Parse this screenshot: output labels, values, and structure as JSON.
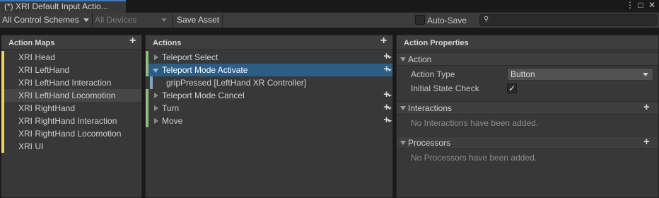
{
  "window": {
    "tab_title": "(*) XRI Default Input Actio...",
    "menu_glyph": "⋮",
    "maximize_glyph": "□",
    "close_glyph": "✕"
  },
  "toolbar": {
    "control_schemes": "All Control Schemes",
    "devices": "All Devices",
    "save_asset": "Save Asset",
    "auto_save": "Auto-Save",
    "search_value": "",
    "search_icon": "🔍"
  },
  "action_maps": {
    "title": "Action Maps",
    "add_glyph": "+",
    "accent_color": "#ecd26a",
    "items": [
      {
        "label": "XRI Head"
      },
      {
        "label": "XRI LeftHand"
      },
      {
        "label": "XRI LeftHand Interaction"
      },
      {
        "label": "XRI LeftHand Locomotion"
      },
      {
        "label": "XRI RightHand"
      },
      {
        "label": "XRI RightHand Interaction"
      },
      {
        "label": "XRI RightHand Locomotion"
      },
      {
        "label": "XRI UI"
      }
    ],
    "selected_index": 3
  },
  "actions": {
    "title": "Actions",
    "add_glyph": "+",
    "action_color": "#8dbd7b",
    "binding_color": "#79a8c6",
    "items": [
      {
        "label": "Teleport Select",
        "expanded": false
      },
      {
        "label": "Teleport Mode Activate",
        "expanded": true
      },
      {
        "label": "gripPressed [LeftHand XR Controller]",
        "binding": true
      },
      {
        "label": "Teleport Mode Cancel",
        "expanded": false
      },
      {
        "label": "Turn",
        "expanded": false
      },
      {
        "label": "Move",
        "expanded": false
      }
    ],
    "selected_index": 1
  },
  "properties": {
    "title": "Action Properties",
    "action_section": "Action",
    "action_type_label": "Action Type",
    "action_type_value": "Button",
    "initial_state_label": "Initial State Check",
    "initial_state_checked": true,
    "check_glyph": "✓",
    "interactions_section": "Interactions",
    "interactions_empty": "No Interactions have been added.",
    "processors_section": "Processors",
    "processors_empty": "No Processors have been added.",
    "add_glyph": "+"
  }
}
